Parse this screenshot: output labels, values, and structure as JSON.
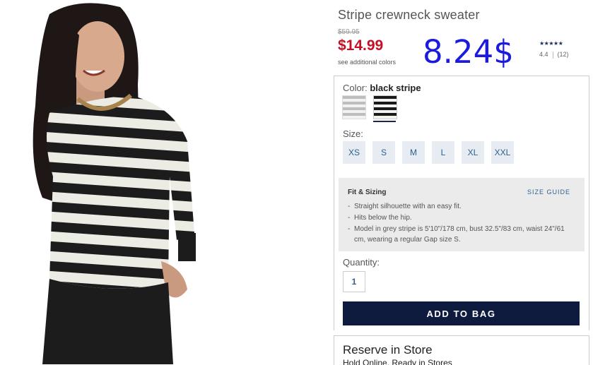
{
  "product": {
    "title": "Stripe crewneck sweater",
    "original_price": "$59.95",
    "sale_price": "$14.99",
    "see_colors": "see additional colors",
    "overlay_price": "8.24$",
    "rating": {
      "stars": "★★★★★",
      "score": "4.4",
      "count": "(12)"
    }
  },
  "color": {
    "label": "Color:",
    "selected": "black stripe",
    "swatches": [
      "grey stripe",
      "black stripe"
    ]
  },
  "size": {
    "label": "Size:",
    "options": [
      "XS",
      "S",
      "M",
      "L",
      "XL",
      "XXL"
    ]
  },
  "fit": {
    "title": "Fit & Sizing",
    "size_guide": "SIZE GUIDE",
    "items": [
      "Straight silhouette with an easy fit.",
      "Hits below the hip.",
      "Model in grey stripe is 5'10\"/178 cm, bust 32.5\"/83 cm, waist 24\"/61 cm, wearing a regular Gap size S."
    ]
  },
  "quantity": {
    "label": "Quantity:",
    "value": "1"
  },
  "add_to_bag": "ADD TO BAG",
  "store": {
    "title": "Reserve in Store",
    "subtitle": "Hold Online. Ready in Stores"
  },
  "colors": {
    "sale": "#c41022",
    "button": "#0e1a3e",
    "overlay": "#1a1ae0",
    "size_bg": "#e6ecf2",
    "link": "#2f5f8f"
  }
}
